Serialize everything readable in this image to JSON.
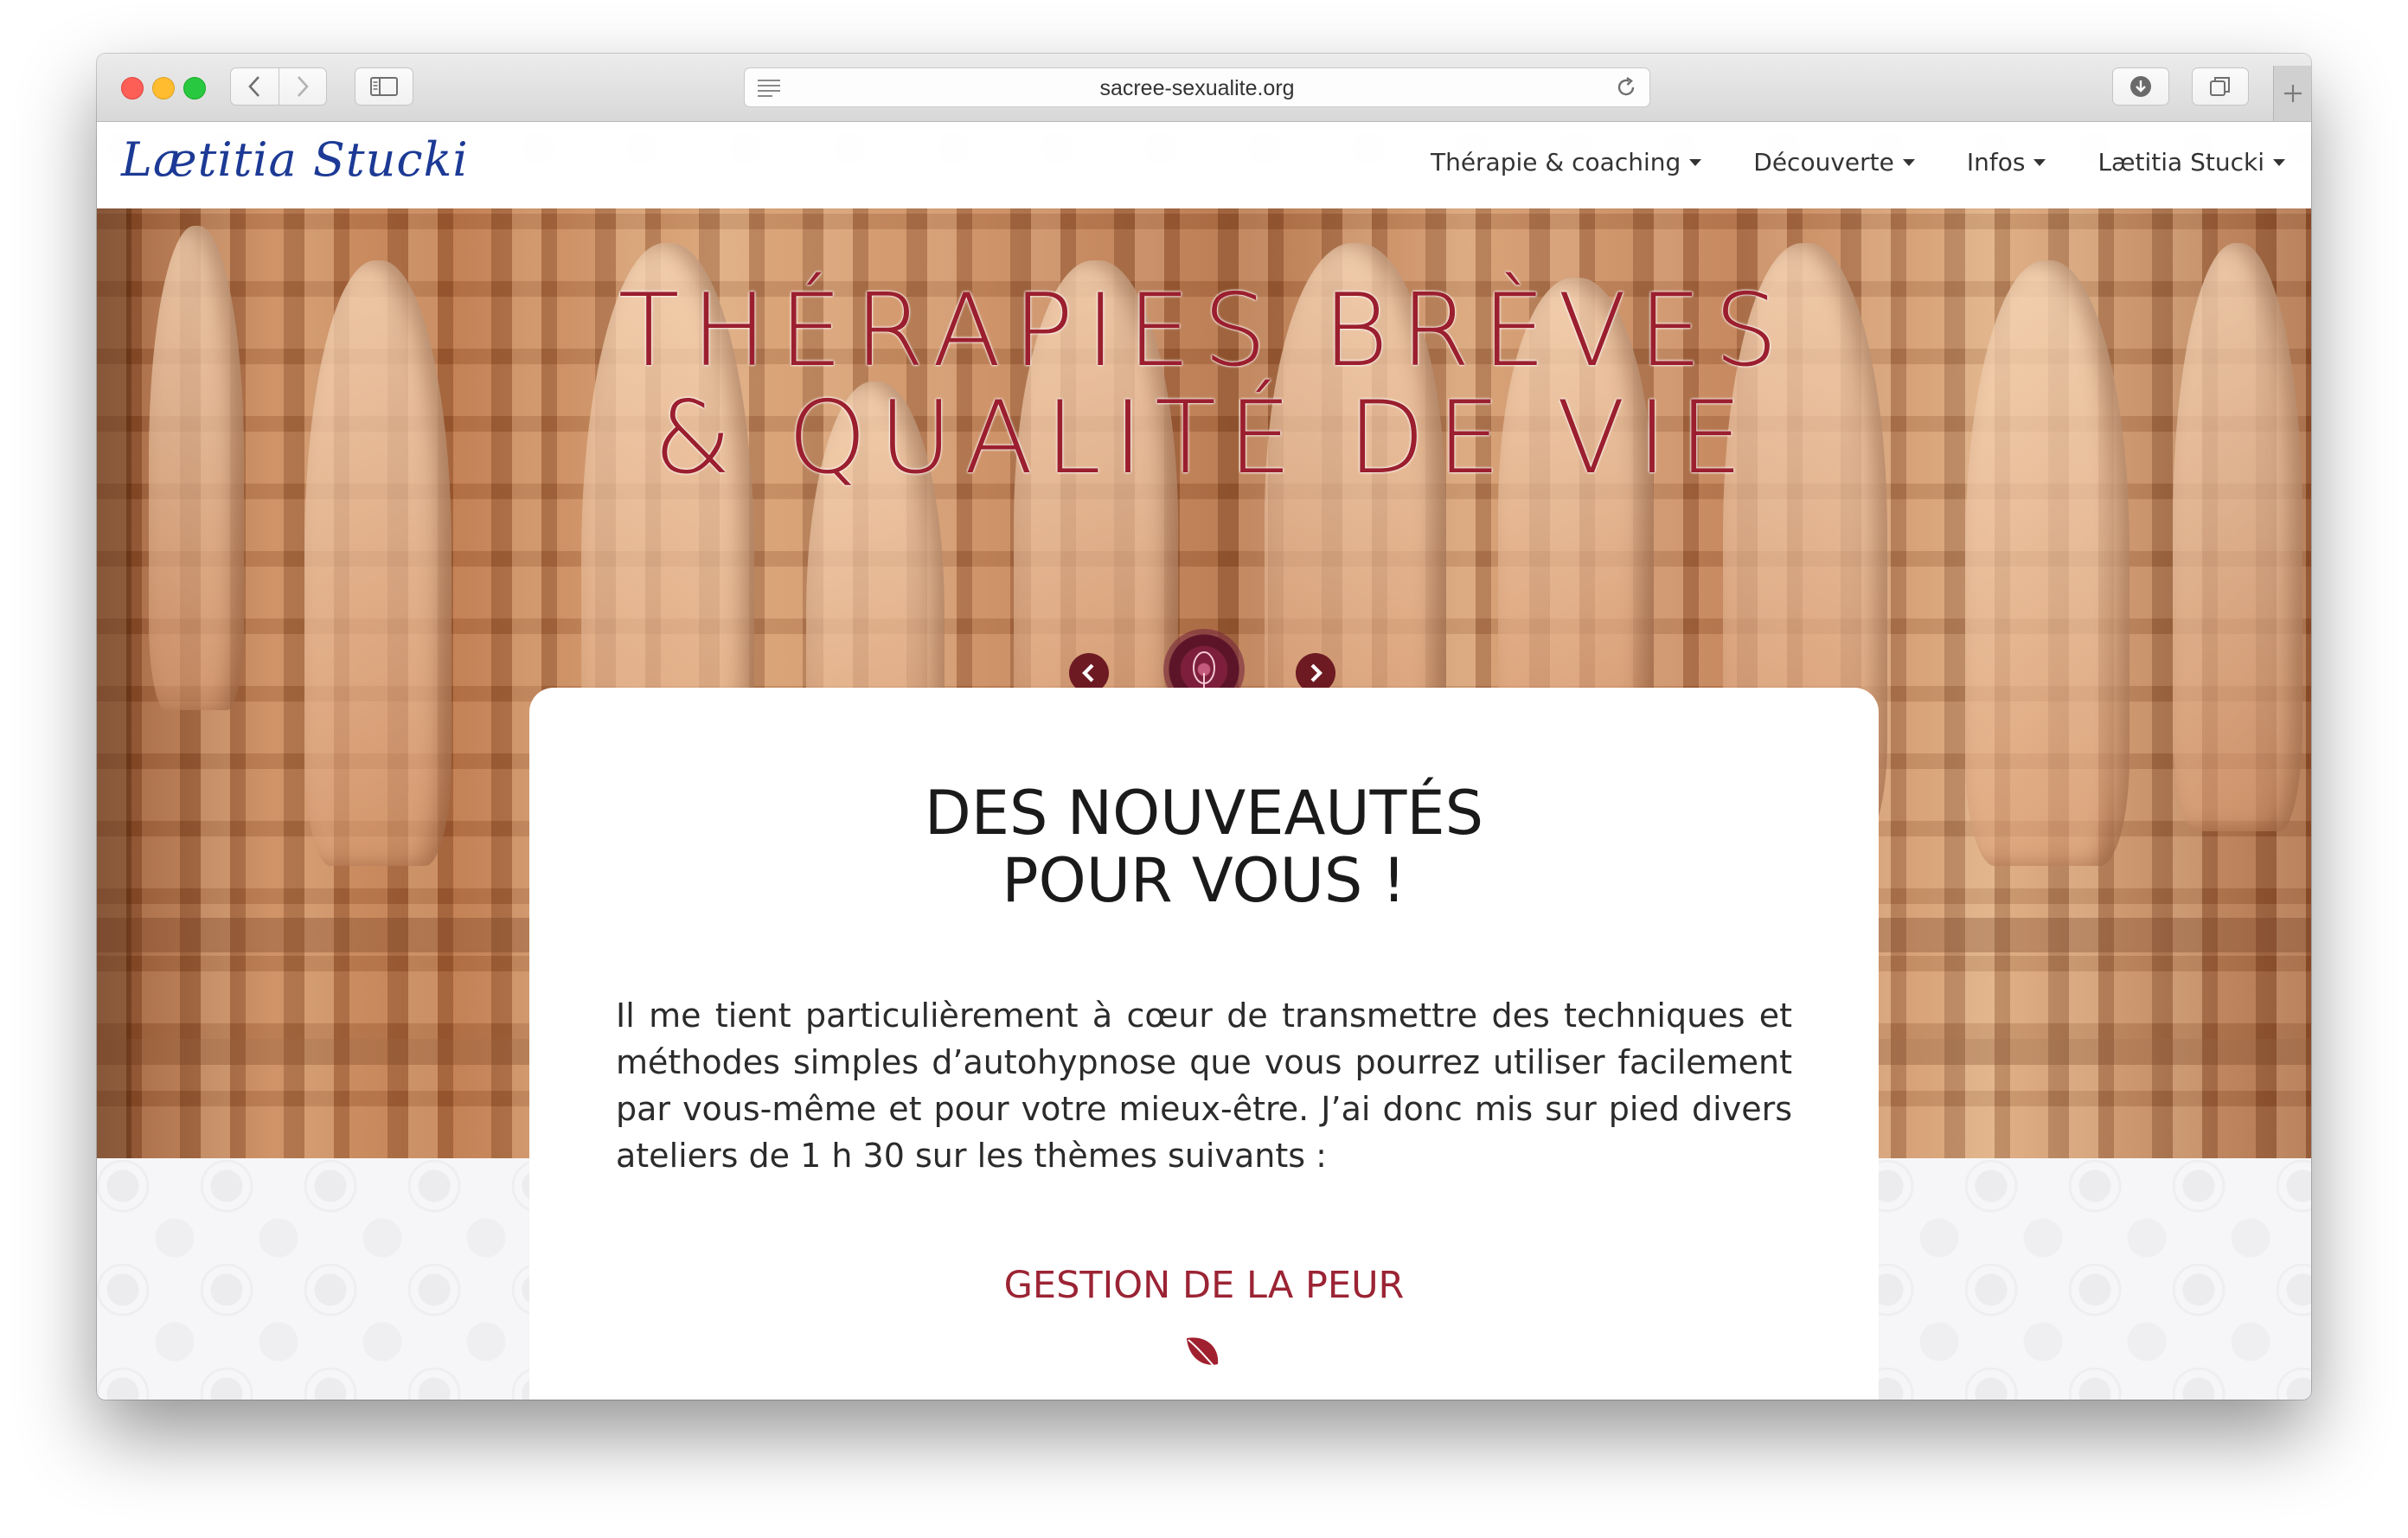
{
  "browser": {
    "url": "sacree-sexualite.org"
  },
  "site": {
    "logo": "Lætitia Stucki",
    "menu": [
      {
        "label": "Thérapie & coaching"
      },
      {
        "label": "Découverte"
      },
      {
        "label": "Infos"
      },
      {
        "label": "Lætitia Stucki"
      }
    ]
  },
  "hero": {
    "title_line1": "THÉRAPIES BRÈVES",
    "title_line2": "& QUALITÉ DE VIE"
  },
  "content": {
    "heading_line1": "DES NOUVEAUTÉS",
    "heading_line2": "POUR VOUS !",
    "paragraph": "Il me tient particulièrement à cœur de transmettre des techniques et méthodes simples d’autohypnose que vous pourrez utiliser facilement par vous-même et pour votre mieux-être. J’ai donc mis sur pied divers ateliers de 1 h 30 sur les thèmes suivants :",
    "section_title": "GESTION DE LA PEUR"
  },
  "colors": {
    "accent": "#9b2434",
    "logo": "#1c3a95",
    "carousel_button": "#6d1a22"
  },
  "icons": [
    "back-icon",
    "forward-icon",
    "sidebar-icon",
    "reader-icon",
    "reload-icon",
    "download-icon",
    "tabs-icon",
    "new-tab-icon",
    "caret-down-icon",
    "chevron-left-icon",
    "chevron-right-icon",
    "leaf-icon"
  ]
}
